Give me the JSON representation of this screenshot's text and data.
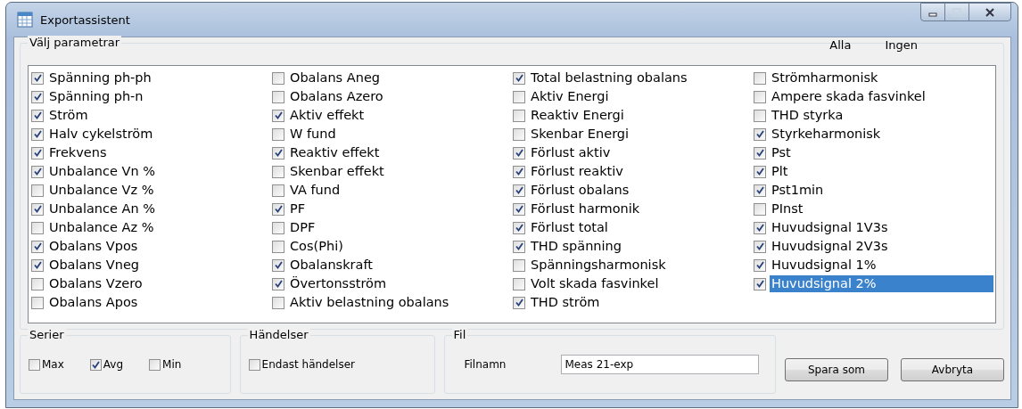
{
  "window": {
    "title": "Exportassistent"
  },
  "parameters": {
    "title": "Välj parametrar",
    "select_all": "Alla",
    "select_none": "Ingen",
    "columns": [
      [
        {
          "label": "Spänning ph-ph",
          "checked": true,
          "selected": false
        },
        {
          "label": "Spänning ph-n",
          "checked": true,
          "selected": false
        },
        {
          "label": "Ström",
          "checked": true,
          "selected": false
        },
        {
          "label": "Halv cykelström",
          "checked": true,
          "selected": false
        },
        {
          "label": "Frekvens",
          "checked": true,
          "selected": false
        },
        {
          "label": "Unbalance Vn %",
          "checked": true,
          "selected": false
        },
        {
          "label": "Unbalance Vz %",
          "checked": false,
          "selected": false
        },
        {
          "label": "Unbalance An %",
          "checked": true,
          "selected": false
        },
        {
          "label": "Unbalance Az %",
          "checked": false,
          "selected": false
        },
        {
          "label": "Obalans Vpos",
          "checked": true,
          "selected": false
        },
        {
          "label": "Obalans Vneg",
          "checked": true,
          "selected": false
        },
        {
          "label": "Obalans Vzero",
          "checked": false,
          "selected": false
        },
        {
          "label": "Obalans Apos",
          "checked": false,
          "selected": false
        }
      ],
      [
        {
          "label": "Obalans Aneg",
          "checked": false,
          "selected": false
        },
        {
          "label": "Obalans Azero",
          "checked": false,
          "selected": false
        },
        {
          "label": "Aktiv effekt",
          "checked": true,
          "selected": false
        },
        {
          "label": "W fund",
          "checked": false,
          "selected": false
        },
        {
          "label": "Reaktiv effekt",
          "checked": true,
          "selected": false
        },
        {
          "label": "Skenbar effekt",
          "checked": false,
          "selected": false
        },
        {
          "label": "VA fund",
          "checked": false,
          "selected": false
        },
        {
          "label": "PF",
          "checked": true,
          "selected": false
        },
        {
          "label": "DPF",
          "checked": false,
          "selected": false
        },
        {
          "label": "Cos(Phi)",
          "checked": false,
          "selected": false
        },
        {
          "label": "Obalanskraft",
          "checked": true,
          "selected": false
        },
        {
          "label": "Övertonsström",
          "checked": true,
          "selected": false
        },
        {
          "label": "Aktiv belastning obalans",
          "checked": false,
          "selected": false
        }
      ],
      [
        {
          "label": "Total belastning obalans",
          "checked": true,
          "selected": false
        },
        {
          "label": "Aktiv Energi",
          "checked": false,
          "selected": false
        },
        {
          "label": "Reaktiv Energi",
          "checked": false,
          "selected": false
        },
        {
          "label": "Skenbar Energi",
          "checked": false,
          "selected": false
        },
        {
          "label": "Förlust aktiv",
          "checked": true,
          "selected": false
        },
        {
          "label": "Förlust reaktiv",
          "checked": true,
          "selected": false
        },
        {
          "label": "Förlust obalans",
          "checked": true,
          "selected": false
        },
        {
          "label": "Förlust harmonik",
          "checked": true,
          "selected": false
        },
        {
          "label": "Förlust total",
          "checked": true,
          "selected": false
        },
        {
          "label": "THD spänning",
          "checked": true,
          "selected": false
        },
        {
          "label": "Spänningsharmonisk",
          "checked": false,
          "selected": false
        },
        {
          "label": "Volt skada fasvinkel",
          "checked": false,
          "selected": false
        },
        {
          "label": "THD ström",
          "checked": true,
          "selected": false
        }
      ],
      [
        {
          "label": "Strömharmonisk",
          "checked": false,
          "selected": false
        },
        {
          "label": "Ampere skada fasvinkel",
          "checked": false,
          "selected": false
        },
        {
          "label": "THD styrka",
          "checked": false,
          "selected": false
        },
        {
          "label": "Styrkeharmonisk",
          "checked": true,
          "selected": false
        },
        {
          "label": "Pst",
          "checked": true,
          "selected": false
        },
        {
          "label": "Plt",
          "checked": true,
          "selected": false
        },
        {
          "label": "Pst1min",
          "checked": true,
          "selected": false
        },
        {
          "label": "PInst",
          "checked": false,
          "selected": false
        },
        {
          "label": "Huvudsignal 1V3s",
          "checked": true,
          "selected": false
        },
        {
          "label": "Huvudsignal 2V3s",
          "checked": true,
          "selected": false
        },
        {
          "label": "Huvudsignal 1%",
          "checked": true,
          "selected": false
        },
        {
          "label": "Huvudsignal 2%",
          "checked": true,
          "selected": true
        }
      ]
    ]
  },
  "series": {
    "title": "Serier",
    "options": [
      {
        "label": "Max",
        "checked": false
      },
      {
        "label": "Avg",
        "checked": true
      },
      {
        "label": "Min",
        "checked": false
      }
    ]
  },
  "events": {
    "title": "Händelser",
    "options": [
      {
        "label": "Endast händelser",
        "checked": false
      }
    ]
  },
  "file": {
    "title": "Fil",
    "label": "Filnamn",
    "value": "Meas 21-exp"
  },
  "buttons": [
    "Spara som",
    "Avbryta"
  ]
}
